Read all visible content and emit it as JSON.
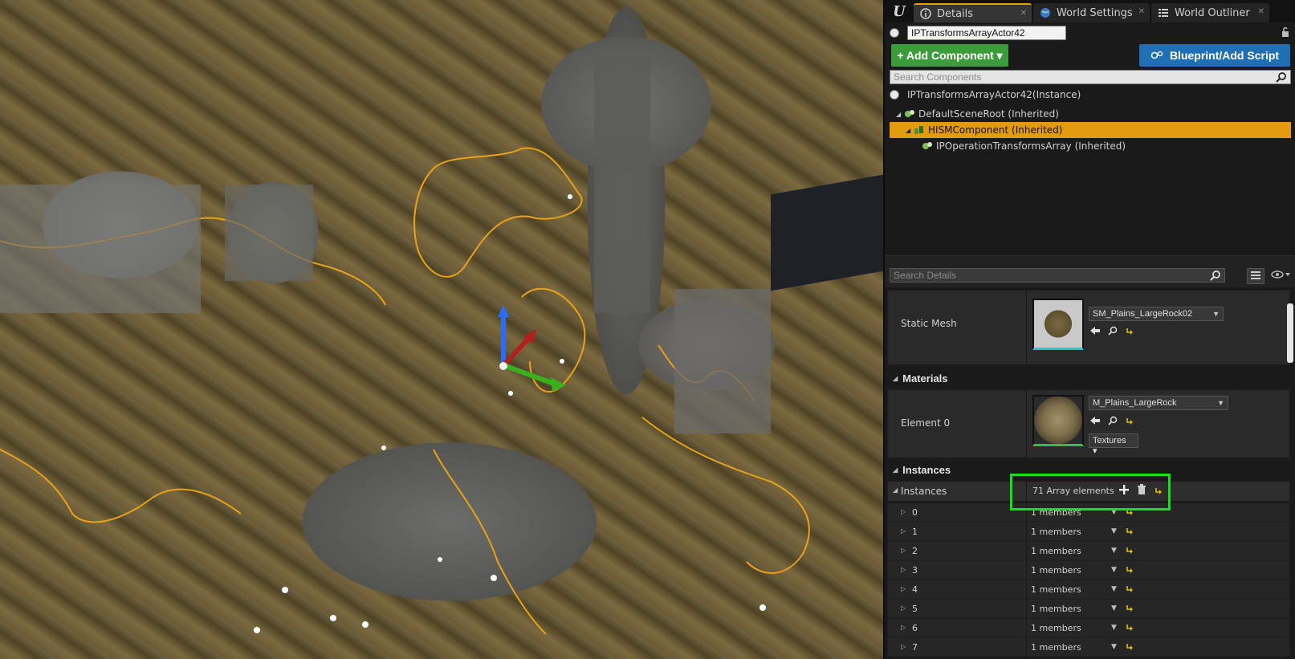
{
  "tabs": [
    {
      "label": "Details",
      "icon": "details-icon",
      "active": true
    },
    {
      "label": "World Settings",
      "icon": "world-icon",
      "active": false
    },
    {
      "label": "World Outliner",
      "icon": "outliner-icon",
      "active": false
    }
  ],
  "actor": {
    "name": "IPTransformsArrayActor42"
  },
  "buttons": {
    "add_component": "+ Add Component ▾",
    "blueprint": "Blueprint/Add Script"
  },
  "components": {
    "search_placeholder": "Search Components",
    "root_instance": "IPTransformsArrayActor42(Instance)",
    "tree": [
      {
        "label": "DefaultSceneRoot (Inherited)",
        "selected": false
      },
      {
        "label": "HISMComponent (Inherited)",
        "selected": true
      },
      {
        "label": "IPOperationTransformsArray (Inherited)",
        "selected": false
      }
    ]
  },
  "details": {
    "search_placeholder": "Search Details",
    "static_mesh": {
      "label": "Static Mesh",
      "value": "SM_Plains_LargeRock02"
    },
    "materials": {
      "header": "Materials",
      "element_label": "Element 0",
      "value": "M_Plains_LargeRock",
      "textures_label": "Textures ▾"
    },
    "instances": {
      "header": "Instances",
      "label": "Instances",
      "array_count": "71 Array elements",
      "rows": [
        {
          "index": "0",
          "value": "1 members"
        },
        {
          "index": "1",
          "value": "1 members"
        },
        {
          "index": "2",
          "value": "1 members"
        },
        {
          "index": "3",
          "value": "1 members"
        },
        {
          "index": "4",
          "value": "1 members"
        },
        {
          "index": "5",
          "value": "1 members"
        },
        {
          "index": "6",
          "value": "1 members"
        },
        {
          "index": "7",
          "value": "1 members"
        }
      ]
    }
  },
  "colors": {
    "selection": "#e29b0e",
    "add_component": "#3d9c3a",
    "blueprint": "#1f6fb4",
    "highlight": "#16e01b"
  }
}
